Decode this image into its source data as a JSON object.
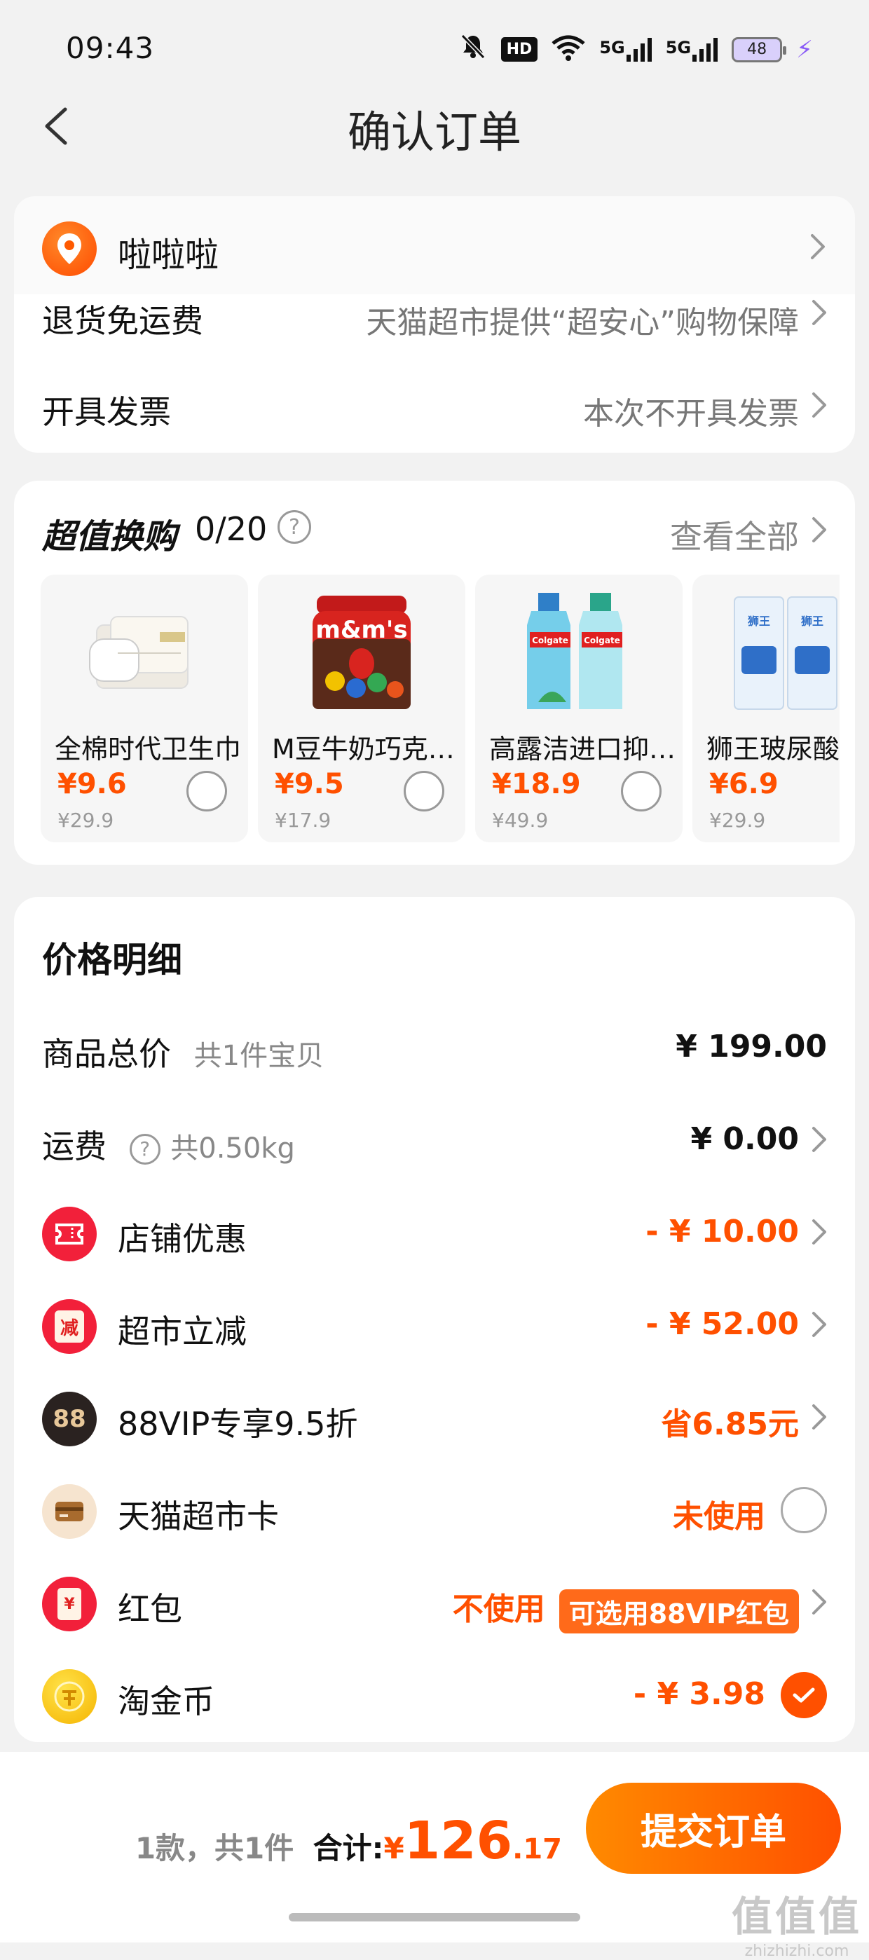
{
  "status_bar": {
    "time": "09:43",
    "battery": "48",
    "hd": "HD",
    "net1": "5G",
    "net2": "5G"
  },
  "header": {
    "title": "确认订单"
  },
  "address": {
    "name": "啦啦啦"
  },
  "service": {
    "return_label": "退货免运费",
    "return_value": "天猫超市提供“超安心”购物保障",
    "invoice_label": "开具发票",
    "invoice_value": "本次不开具发票"
  },
  "exchange": {
    "title": "超值换购",
    "count": "0/20",
    "help": "?",
    "view_all": "查看全部",
    "products": [
      {
        "name": "全棉时代卫生巾",
        "price": "¥9.6",
        "original": "¥29.9"
      },
      {
        "name": "M豆牛奶巧克力豆",
        "price": "¥9.5",
        "original": "¥17.9"
      },
      {
        "name": "高露洁进口抑菌漱口水",
        "price": "¥18.9",
        "original": "¥49.9"
      },
      {
        "name": "狮王玻尿酸",
        "price": "¥6.9",
        "original": "¥29.9"
      }
    ],
    "brand_mm": "m&m's",
    "brand_colgate": "Colgate",
    "brand_lion": "狮王"
  },
  "price": {
    "title": "价格明细",
    "goods_label": "商品总价",
    "goods_sub": "共1件宝贝",
    "goods_value": "¥ 199.00",
    "shipping_label": "运费",
    "shipping_sub": "共0.50kg",
    "shipping_value": "¥ 0.00",
    "shop_discount_label": "店铺优惠",
    "shop_discount_value": "- ¥ 10.00",
    "market_label": "超市立减",
    "market_icon_text": "减",
    "market_value": "- ¥ 52.00",
    "vip_label": "88VIP专享9.5折",
    "vip_icon_text": "88",
    "vip_value": "省6.85元",
    "card_label": "天猫超市卡",
    "card_value": "未使用",
    "redpack_label": "红包",
    "redpack_icon_text": "¥",
    "redpack_value": "不使用",
    "redpack_tag": "可选用88VIP红包",
    "coin_label": "淘金币",
    "coin_value": "- ¥ 3.98"
  },
  "bottom": {
    "count": "1款，共1件",
    "total_label": "合计:",
    "currency": "¥",
    "total_int": "126",
    "total_dec": ".17",
    "submit": "提交订单",
    "watermark": "值值值",
    "watermark_url": "zhizhizhi.com"
  },
  "colors": {
    "accent": "#ff5000",
    "background": "#f2f2f2"
  }
}
